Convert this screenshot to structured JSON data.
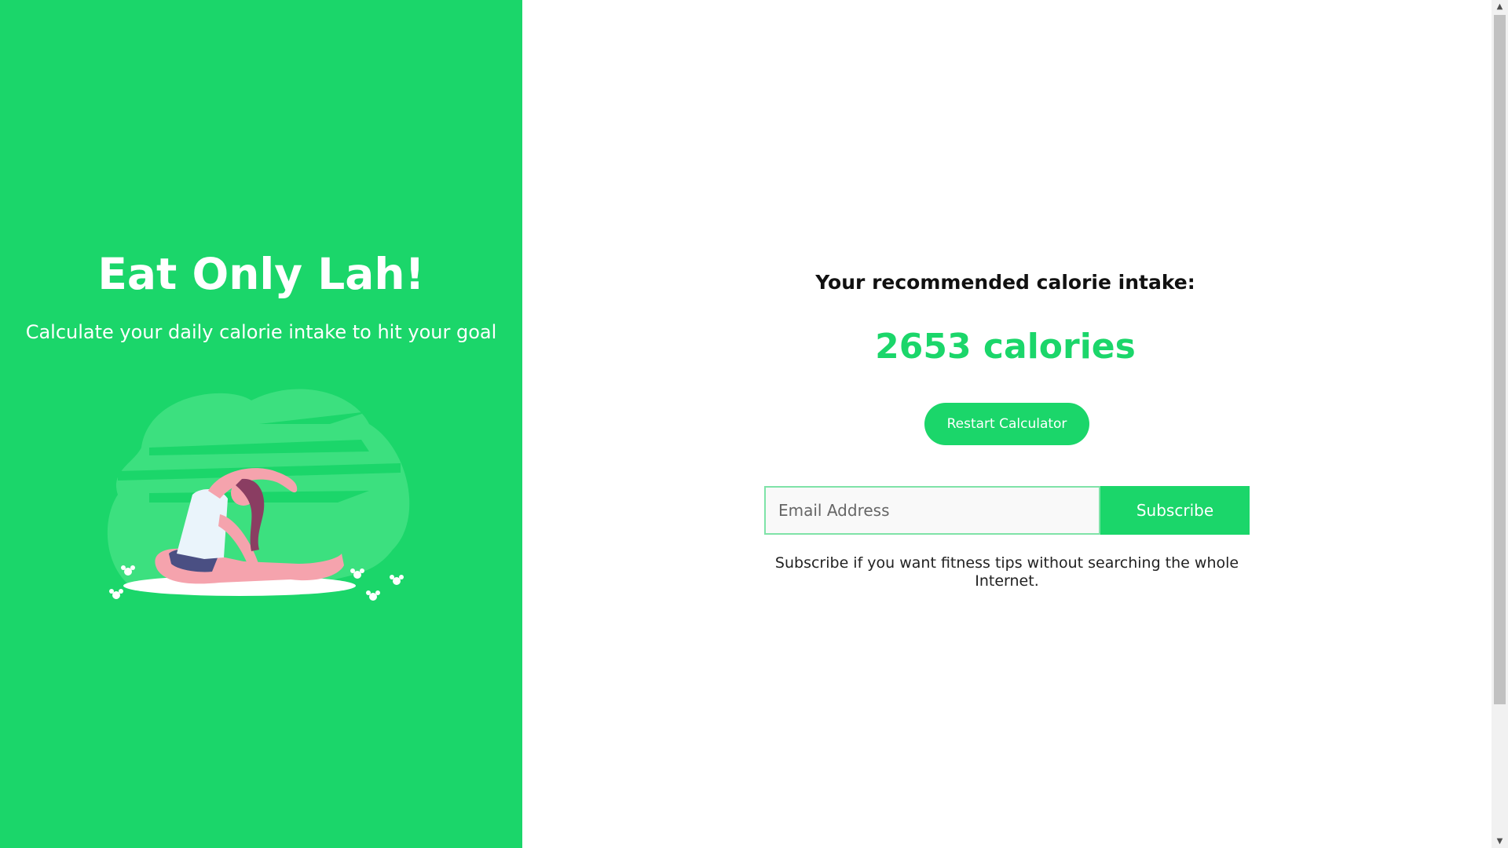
{
  "hero": {
    "title": "Eat Only Lah!",
    "subtitle": "Calculate your daily calorie intake to hit your goal",
    "illustration": "woman-yoga-stretch-illustration"
  },
  "result": {
    "heading": "Your recommended calorie intake:",
    "value": "2653 calories",
    "restart_label": "Restart Calculator"
  },
  "subscribe": {
    "email_value": "",
    "email_placeholder": "Email Address",
    "button_label": "Subscribe",
    "note": "Subscribe if you want fitness tips without searching the whole Internet."
  },
  "scrollbar": {
    "up_icon": "arrow-up-icon",
    "down_icon": "arrow-down-icon"
  },
  "colors": {
    "brand_green": "#1bd66a",
    "text_dark": "#111111",
    "white": "#ffffff"
  }
}
